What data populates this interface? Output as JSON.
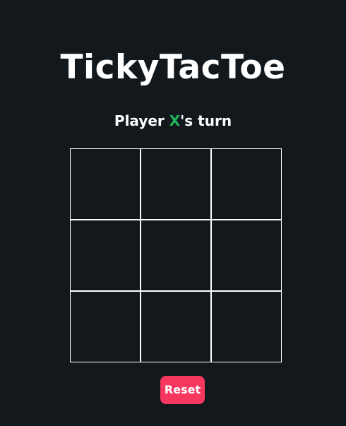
{
  "app": {
    "title": "TickyTacToe"
  },
  "status": {
    "prefix": "Player ",
    "current_player": "X",
    "suffix": "'s turn"
  },
  "board": {
    "cells": [
      "",
      "",
      "",
      "",
      "",
      "",
      "",
      "",
      ""
    ]
  },
  "controls": {
    "reset_label": "Reset"
  },
  "colors": {
    "background": "#13181d",
    "text": "#ffffff",
    "player_x": "#1fb85c",
    "reset_button": "#f8375f",
    "grid_lines": "#ffffff"
  }
}
